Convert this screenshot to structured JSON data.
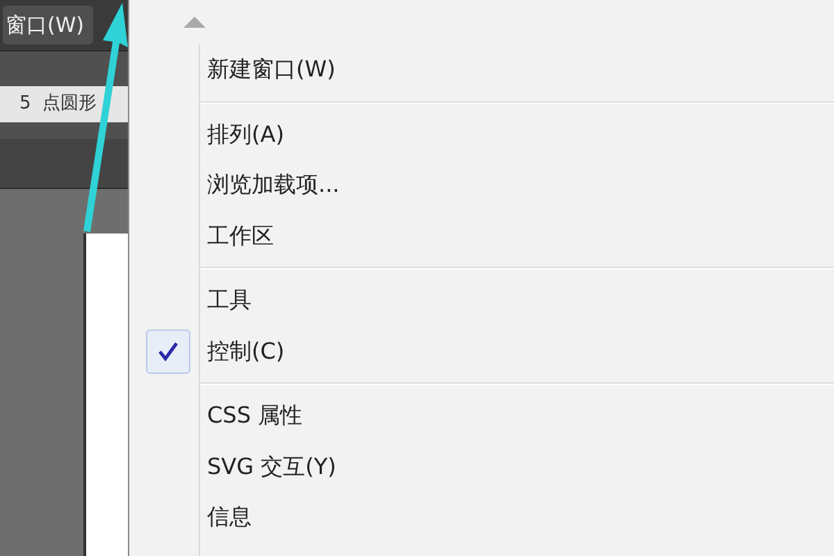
{
  "app": {
    "menu_title": "窗口(W)",
    "control_row": {
      "value": "5",
      "label": "点圆形"
    }
  },
  "menu": {
    "items": [
      {
        "kind": "item",
        "label": "新建窗口(W)",
        "checked": false
      },
      {
        "kind": "separator"
      },
      {
        "kind": "item",
        "label": "排列(A)",
        "checked": false
      },
      {
        "kind": "item",
        "label": "浏览加载项...",
        "checked": false
      },
      {
        "kind": "item",
        "label": "工作区",
        "checked": false
      },
      {
        "kind": "separator"
      },
      {
        "kind": "item",
        "label": "工具",
        "checked": false
      },
      {
        "kind": "item",
        "label": "控制(C)",
        "checked": true
      },
      {
        "kind": "separator"
      },
      {
        "kind": "item",
        "label": "CSS 属性",
        "checked": false
      },
      {
        "kind": "item",
        "label": "SVG 交互(Y)",
        "checked": false
      },
      {
        "kind": "item",
        "label": "信息",
        "checked": false
      }
    ]
  }
}
